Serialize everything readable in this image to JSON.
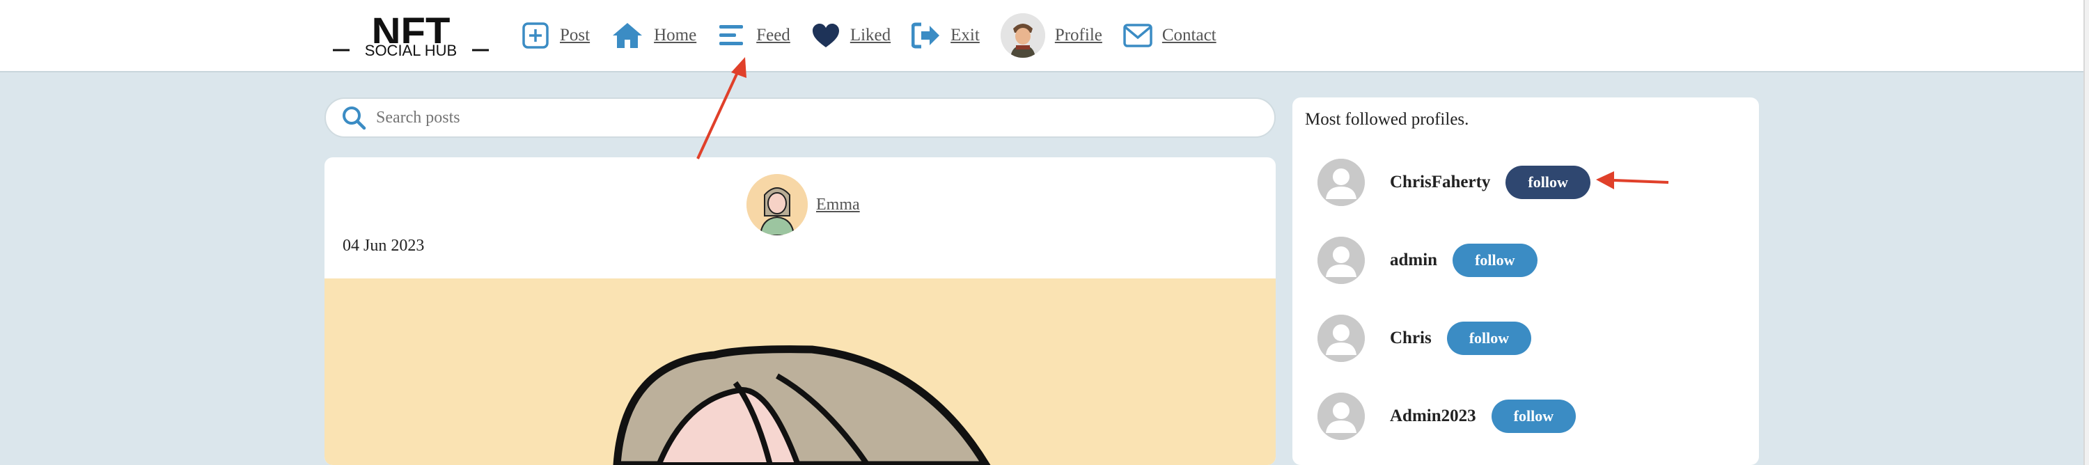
{
  "header": {
    "logo": {
      "text": "NFT",
      "subtext": "SOCIAL HUB"
    },
    "nav": [
      {
        "label": "Post",
        "icon": "plus-square-icon"
      },
      {
        "label": "Home",
        "icon": "home-icon"
      },
      {
        "label": "Feed",
        "icon": "bars-icon"
      },
      {
        "label": "Liked",
        "icon": "heart-icon"
      },
      {
        "label": "Exit",
        "icon": "sign-out-icon"
      },
      {
        "label": "Profile",
        "icon": "avatar"
      },
      {
        "label": "Contact",
        "icon": "envelope-icon"
      }
    ]
  },
  "search": {
    "placeholder": "Search posts",
    "value": ""
  },
  "post": {
    "author": "Emma",
    "date": "04 Jun 2023"
  },
  "sidebar": {
    "title": "Most followed profiles.",
    "profiles": [
      {
        "name": "ChrisFaherty",
        "button": "follow"
      },
      {
        "name": "admin",
        "button": "follow"
      },
      {
        "name": "Chris",
        "button": "follow"
      },
      {
        "name": "Admin2023",
        "button": "follow"
      }
    ]
  },
  "colors": {
    "accent": "#3b8cc4",
    "accent_dark": "#2f4770",
    "page_bg": "#dbe6ec",
    "annotation": "#e0402a"
  }
}
